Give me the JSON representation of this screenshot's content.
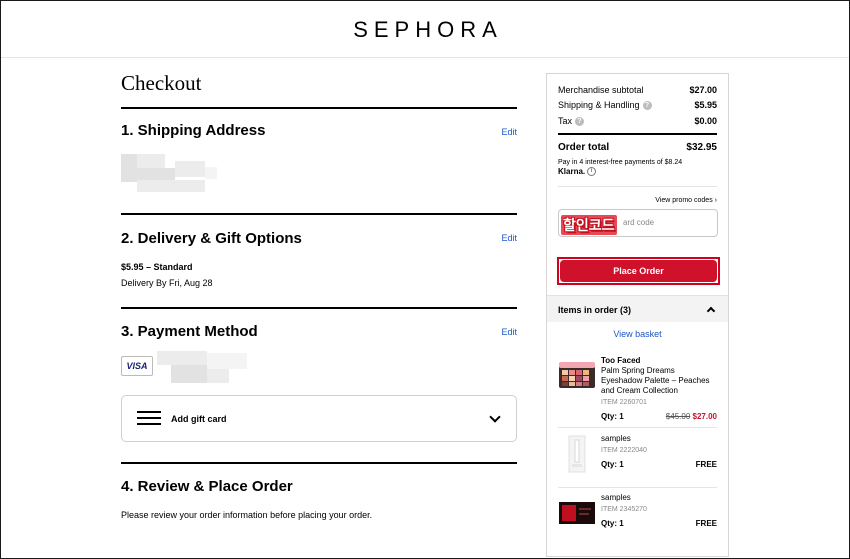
{
  "brand": "SEPHORA",
  "page_title": "Checkout",
  "sections": {
    "shipping": {
      "title": "1. Shipping Address",
      "edit": "Edit"
    },
    "delivery": {
      "title": "2. Delivery & Gift Options",
      "edit": "Edit",
      "method": "$5.95 – Standard",
      "eta": "Delivery By Fri, Aug 28"
    },
    "payment": {
      "title": "3. Payment Method",
      "edit": "Edit",
      "card_brand": "VISA",
      "gift_card_label": "Add gift card"
    },
    "review": {
      "title": "4. Review & Place Order",
      "note": "Please review your order information before placing your order."
    }
  },
  "summary": {
    "subtotal_label": "Merchandise subtotal",
    "subtotal_value": "$27.00",
    "shipping_label": "Shipping & Handling",
    "shipping_value": "$5.95",
    "tax_label": "Tax",
    "tax_value": "$0.00",
    "total_label": "Order total",
    "total_value": "$32.95",
    "klarna_text": "Pay in 4 interest-free payments of $8.24",
    "klarna_brand": "Klarna.",
    "promo_link": "View promo codes",
    "promo_placeholder": "ard code",
    "promo_overlay": "할인코드",
    "place_order": "Place Order",
    "items_label": "Items in order (3)",
    "view_basket": "View basket"
  },
  "items": [
    {
      "brand": "Too Faced",
      "name": "Palm Spring Dreams Eyeshadow Palette – Peaches and Cream Collection",
      "item_no": "ITEM 2260701",
      "qty": "Qty: 1",
      "old_price": "$45.00",
      "price": "$27.00"
    },
    {
      "brand": "samples",
      "item_no": "ITEM 2222040",
      "qty": "Qty: 1",
      "price": "FREE"
    },
    {
      "brand": "samples",
      "item_no": "ITEM 2345270",
      "qty": "Qty: 1",
      "price": "FREE"
    }
  ],
  "colors": {
    "accent_red": "#cf112c",
    "link_blue": "#1a56c9"
  }
}
